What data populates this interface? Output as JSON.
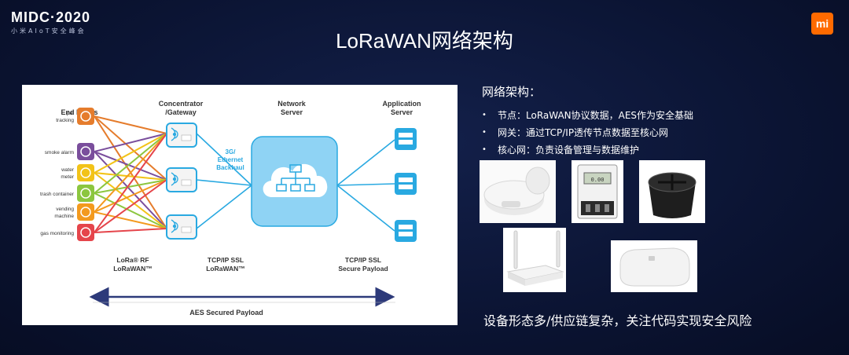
{
  "header": {
    "logo_main": "MIDC·2020",
    "logo_sub": "小米AIoT安全峰会",
    "brand_badge": "mi"
  },
  "slide": {
    "title": "LoRaWAN网络架构"
  },
  "diagram": {
    "col_end_nodes": "End Nodes",
    "col_gateway_1": "Concentrator",
    "col_gateway_2": "/Gateway",
    "col_network_1": "Network",
    "col_network_2": "Server",
    "col_app_1": "Application",
    "col_app_2": "Server",
    "nodes": [
      {
        "label_1": "pet",
        "label_2": "tracking",
        "color": "#e57c2c",
        "icon": "paw-icon"
      },
      {
        "label_1": "smoke alarm",
        "label_2": "",
        "color": "#7a4e9c",
        "icon": "smoke-alarm-icon"
      },
      {
        "label_1": "water",
        "label_2": "meter",
        "color": "#f2c318",
        "icon": "water-meter-icon"
      },
      {
        "label_1": "trash container",
        "label_2": "",
        "color": "#8cc63f",
        "icon": "trash-icon"
      },
      {
        "label_1": "vending",
        "label_2": "machine",
        "color": "#f39a1e",
        "icon": "vending-machine-icon"
      },
      {
        "label_1": "gas monitoring",
        "label_2": "",
        "color": "#e5454b",
        "icon": "gas-icon"
      }
    ],
    "backhaul_1": "3G/",
    "backhaul_2": "Ethernet",
    "backhaul_3": "Backhaul",
    "proto_rf_1": "LoRa® RF",
    "proto_rf_2": "LoRaWAN™",
    "proto_tcp_1": "TCP/IP SSL",
    "proto_tcp_2": "LoRaWAN™",
    "proto_secure_1": "TCP/IP SSL",
    "proto_secure_2": "Secure Payload",
    "aes_label": "AES Secured Payload",
    "accent": "#29a9e1",
    "text_color": "#333333"
  },
  "right": {
    "heading": "网络架构：",
    "bullets": [
      "节点：LoRaWAN协议数据，AES作为安全基础",
      "网关：通过TCP/IP透传节点数据至核心网",
      "核心网：负责设备管理与数据维护"
    ],
    "bullet_char": "•",
    "meter_display": "0.00",
    "bottom_text": "设备形态多/供应链复杂，关注代码实现安全风险"
  }
}
